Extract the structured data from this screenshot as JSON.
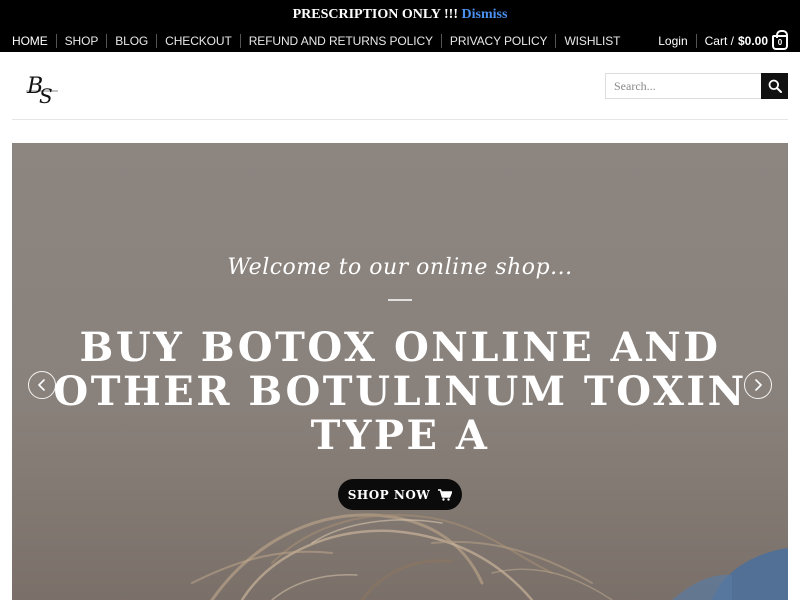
{
  "notice": {
    "text": "PRESCRIPTION ONLY !!!",
    "dismiss": "Dismiss"
  },
  "nav": {
    "items": [
      "HOME",
      "SHOP",
      "BLOG",
      "CHECKOUT",
      "REFUND AND RETURNS POLICY",
      "PRIVACY POLICY",
      "WISHLIST"
    ],
    "login": "Login",
    "cart_label": "Cart /",
    "cart_amount": "$0.00",
    "cart_count": "0"
  },
  "header": {
    "logo_text": "BS",
    "search_placeholder": "Search..."
  },
  "hero": {
    "welcome": "Welcome to our online shop...",
    "headline": "BUY BOTOX ONLINE AND OTHER BOTULINUM TOXIN TYPE A",
    "cta": "SHOP NOW"
  },
  "colors": {
    "bar_bg": "#000000",
    "dismiss": "#4a90f0",
    "hero_bg": "#8a827c",
    "button_bg": "#0b0b0b"
  },
  "icons": [
    "cart-bag-icon",
    "search-icon",
    "chevron-left-icon",
    "chevron-right-icon",
    "shopping-cart-icon"
  ]
}
